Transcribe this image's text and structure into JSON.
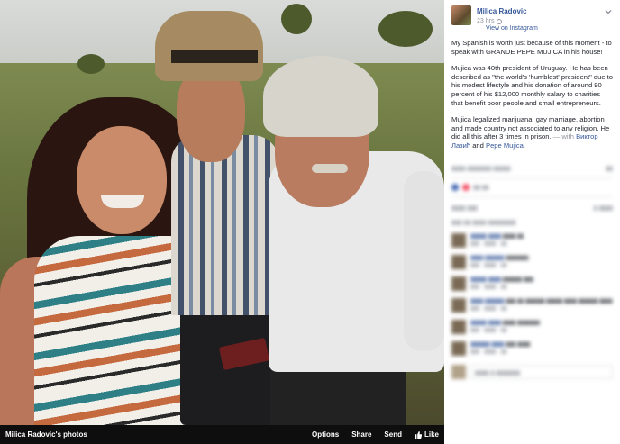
{
  "album": {
    "label": "Milica Radovic's photos"
  },
  "actions": {
    "options": "Options",
    "share": "Share",
    "send": "Send",
    "like": "Like"
  },
  "post": {
    "author": "Milica Radovic",
    "time": "23 hrs",
    "via": "View on Instagram",
    "p1": "My Spanish is worth just because of this moment - to speak with GRANDE PEPE MUJICA in his house!",
    "p2": "Mujica was 40th president of Uruguay. He has been described as \"the world's 'humblest' president\" due to his modest lifestyle and his donation of around 90 percent of his $12,000 monthly salary to charities that benefit poor people and small entrepreneurs.",
    "p3": "Mujica legalized marijuana, gay marriage, abortion and made country not associated to any religion. He did all this after 3 times in prison.",
    "with_prefix": "— with",
    "with_1": "Виктор Лазић",
    "with_and": "and",
    "with_2": "Pepe Mujica",
    "with_end": "."
  }
}
